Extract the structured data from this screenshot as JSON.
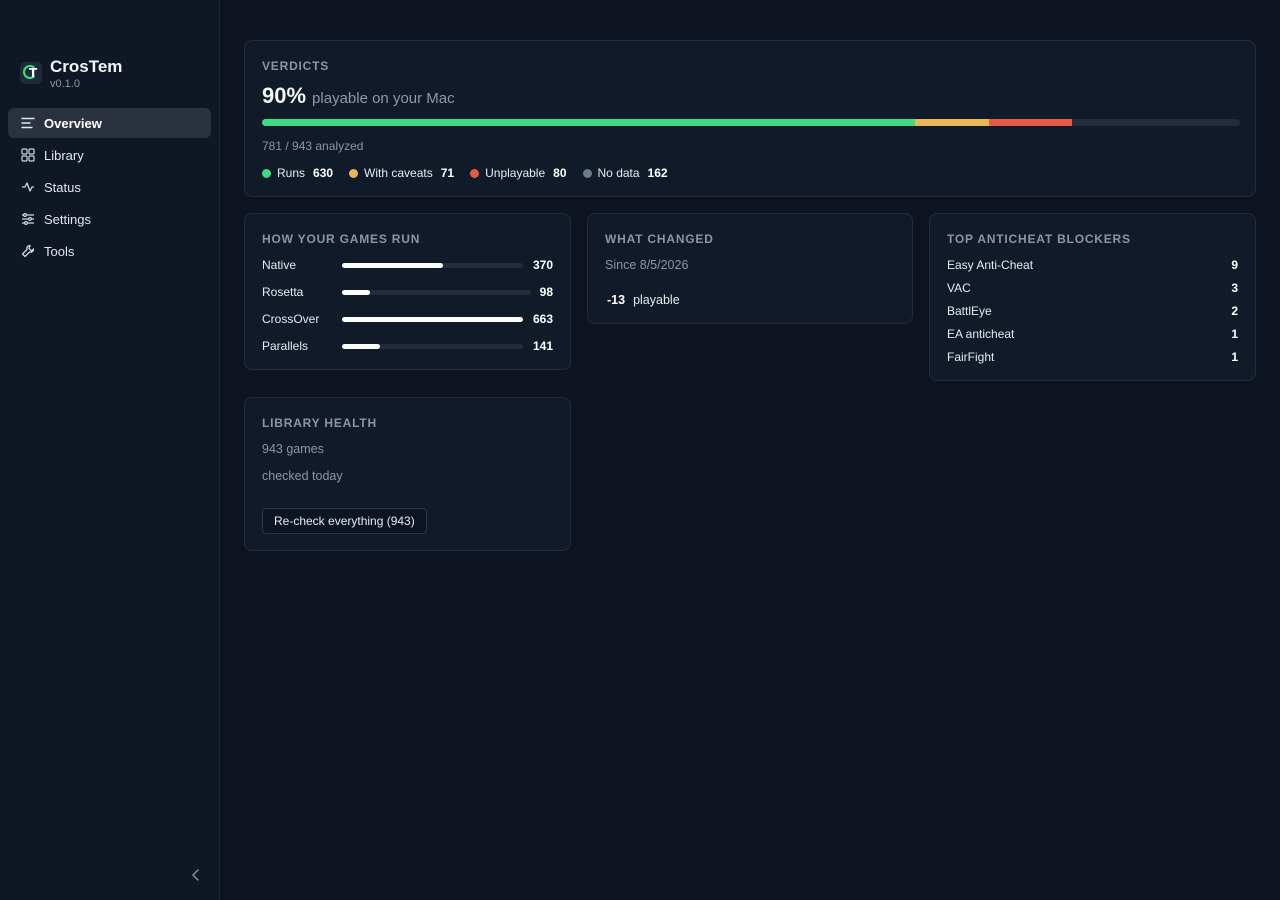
{
  "app": {
    "name": "CrosTem",
    "version": "v0.1.0"
  },
  "nav": [
    {
      "label": "Overview",
      "icon": "list-icon",
      "active": true
    },
    {
      "label": "Library",
      "icon": "grid-icon",
      "active": false
    },
    {
      "label": "Status",
      "icon": "activity-icon",
      "active": false
    },
    {
      "label": "Settings",
      "icon": "sliders-icon",
      "active": false
    },
    {
      "label": "Tools",
      "icon": "wrench-icon",
      "active": false
    }
  ],
  "verdicts": {
    "title": "VERDICTS",
    "percent": "90%",
    "percent_label": "playable on your Mac",
    "analyzed": "781 / 943 analyzed",
    "segments": [
      {
        "label": "Runs",
        "value": "630",
        "color": "#3ddc84"
      },
      {
        "label": "With caveats",
        "value": "71",
        "color": "#e8b856"
      },
      {
        "label": "Unplayable",
        "value": "80",
        "color": "#e85a44"
      },
      {
        "label": "No data",
        "value": "162",
        "color": "#6b7a8e"
      }
    ]
  },
  "how_run": {
    "title": "HOW YOUR GAMES RUN",
    "rows": [
      {
        "label": "Native",
        "value": "370",
        "fraction": 0.56
      },
      {
        "label": "Rosetta",
        "value": "98",
        "fraction": 0.15
      },
      {
        "label": "CrossOver",
        "value": "663",
        "fraction": 1.0
      },
      {
        "label": "Parallels",
        "value": "141",
        "fraction": 0.21
      }
    ]
  },
  "changed": {
    "title": "WHAT CHANGED",
    "since": "Since 8/5/2026",
    "delta": "-13",
    "delta_label": "playable"
  },
  "anticheat": {
    "title": "TOP ANTICHEAT BLOCKERS",
    "rows": [
      {
        "label": "Easy Anti-Cheat",
        "value": "9"
      },
      {
        "label": "VAC",
        "value": "3"
      },
      {
        "label": "BattlEye",
        "value": "2"
      },
      {
        "label": "EA anticheat",
        "value": "1"
      },
      {
        "label": "FairFight",
        "value": "1"
      }
    ]
  },
  "health": {
    "title": "LIBRARY HEALTH",
    "games": "943 games",
    "checked": "checked today",
    "button": "Re-check everything (943)"
  }
}
